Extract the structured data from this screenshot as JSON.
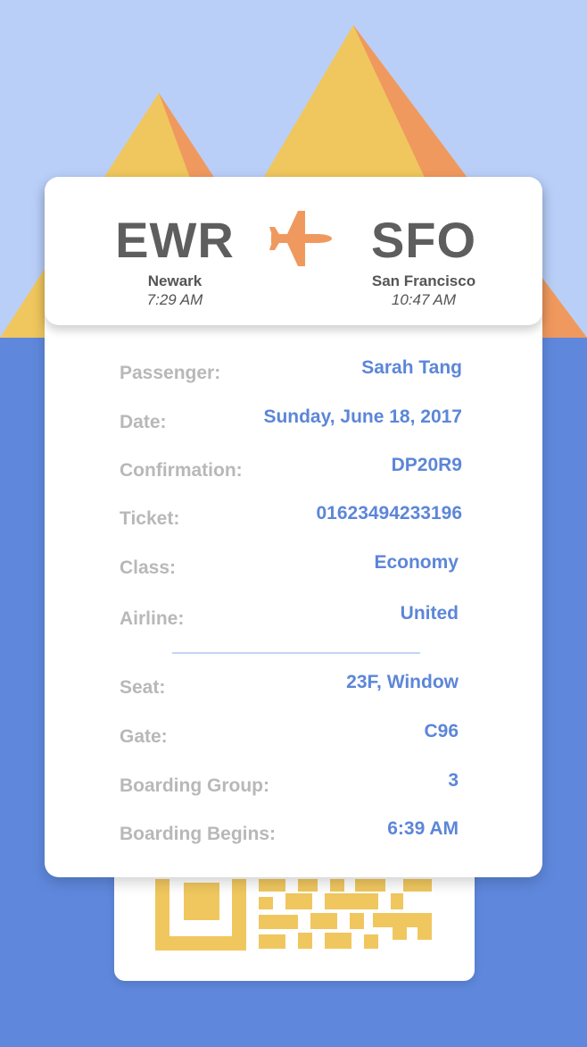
{
  "route": {
    "origin": {
      "code": "EWR",
      "city": "Newark",
      "time": "7:29 AM"
    },
    "destination": {
      "code": "SFO",
      "city": "San Francisco",
      "time": "10:47 AM"
    },
    "icon": "airplane-icon"
  },
  "details": [
    {
      "label": "Passenger:",
      "value": "Sarah Tang"
    },
    {
      "label": "Date:",
      "value": "Sunday, June 18, 2017"
    },
    {
      "label": "Confirmation:",
      "value": "DP20R9"
    },
    {
      "label": "Ticket:",
      "value": "01623494233196"
    },
    {
      "label": "Class:",
      "value": "Economy"
    },
    {
      "label": "Airline:",
      "value": "United"
    }
  ],
  "boarding": [
    {
      "label": "Seat:",
      "value": "23F, Window"
    },
    {
      "label": "Gate:",
      "value": "C96"
    },
    {
      "label": "Boarding Group:",
      "value": "3"
    },
    {
      "label": "Boarding Begins:",
      "value": "6:39 AM"
    }
  ],
  "colors": {
    "sky": "#b9cff8",
    "ground": "#5f88dd",
    "mountain_light": "#f0c75e",
    "mountain_shadow": "#f0995e",
    "plane": "#f0995e",
    "value_text": "#5c86d8",
    "label_text": "#b8b8b8"
  }
}
